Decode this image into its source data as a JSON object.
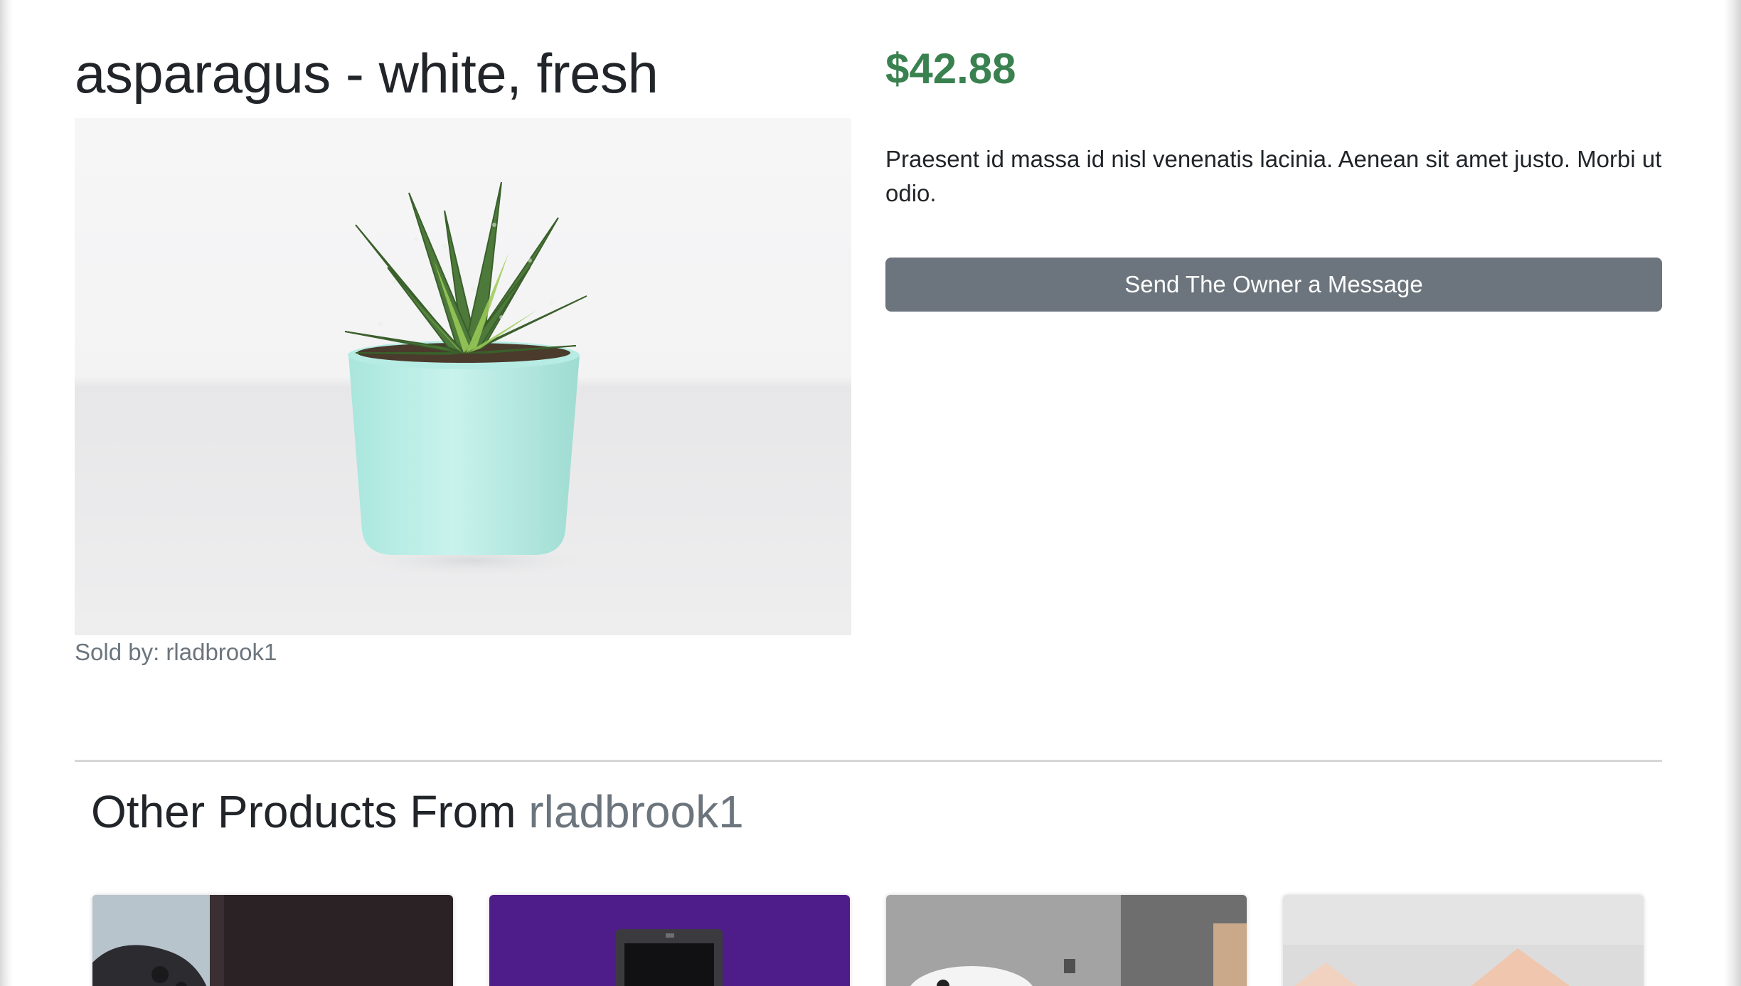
{
  "product": {
    "title": "asparagus - white, fresh",
    "price": "$42.88",
    "description": "Praesent id massa id nisl venenatis lacinia. Aenean sit amet justo. Morbi ut odio.",
    "sold_by_label": "Sold by:",
    "seller": "rladbrook1",
    "message_button_label": "Send The Owner a Message",
    "image_alt": "potted succulent in mint pot"
  },
  "other_products": {
    "heading_prefix": "Other Products From",
    "seller": "rladbrook1",
    "cards": [
      {
        "image_alt": "game controller"
      },
      {
        "image_alt": "device on purple background"
      },
      {
        "image_alt": "white game controller"
      },
      {
        "image_alt": "pink shapes"
      }
    ]
  },
  "colors": {
    "price": "#3a8150",
    "button": "#6c757d",
    "muted_text": "#6c757d"
  }
}
